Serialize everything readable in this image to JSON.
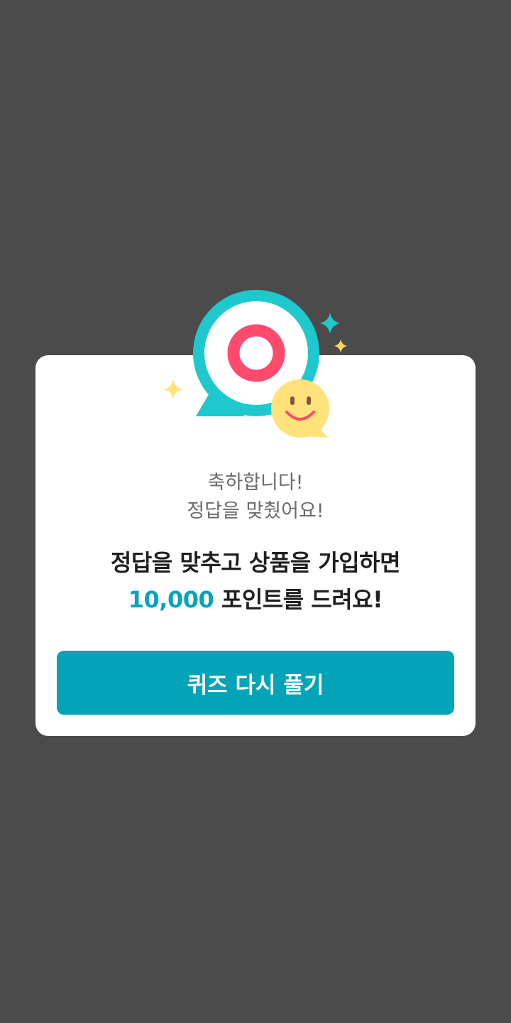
{
  "dialog": {
    "congrats_line1": "축하합니다!",
    "congrats_line2": "정답을 맞췄어요!",
    "reward_line1": "정답을 맞추고 상품을 가입하면",
    "reward_points": "10,000",
    "reward_line2_suffix": " 포인트를 드려요!",
    "retry_button_label": "퀴즈 다시 풀기"
  },
  "illustration": {
    "icons": [
      "correct-answer-o-bubble-icon",
      "smiley-bubble-icon",
      "sparkle-icon"
    ]
  },
  "colors": {
    "overlay_background": "#4b4b4b",
    "dialog_background": "#ffffff",
    "accent_teal": "#03a3b8",
    "bubble_teal": "#1ec8cc",
    "answer_red": "#ff4a6e",
    "smiley_yellow": "#ffe27a"
  }
}
